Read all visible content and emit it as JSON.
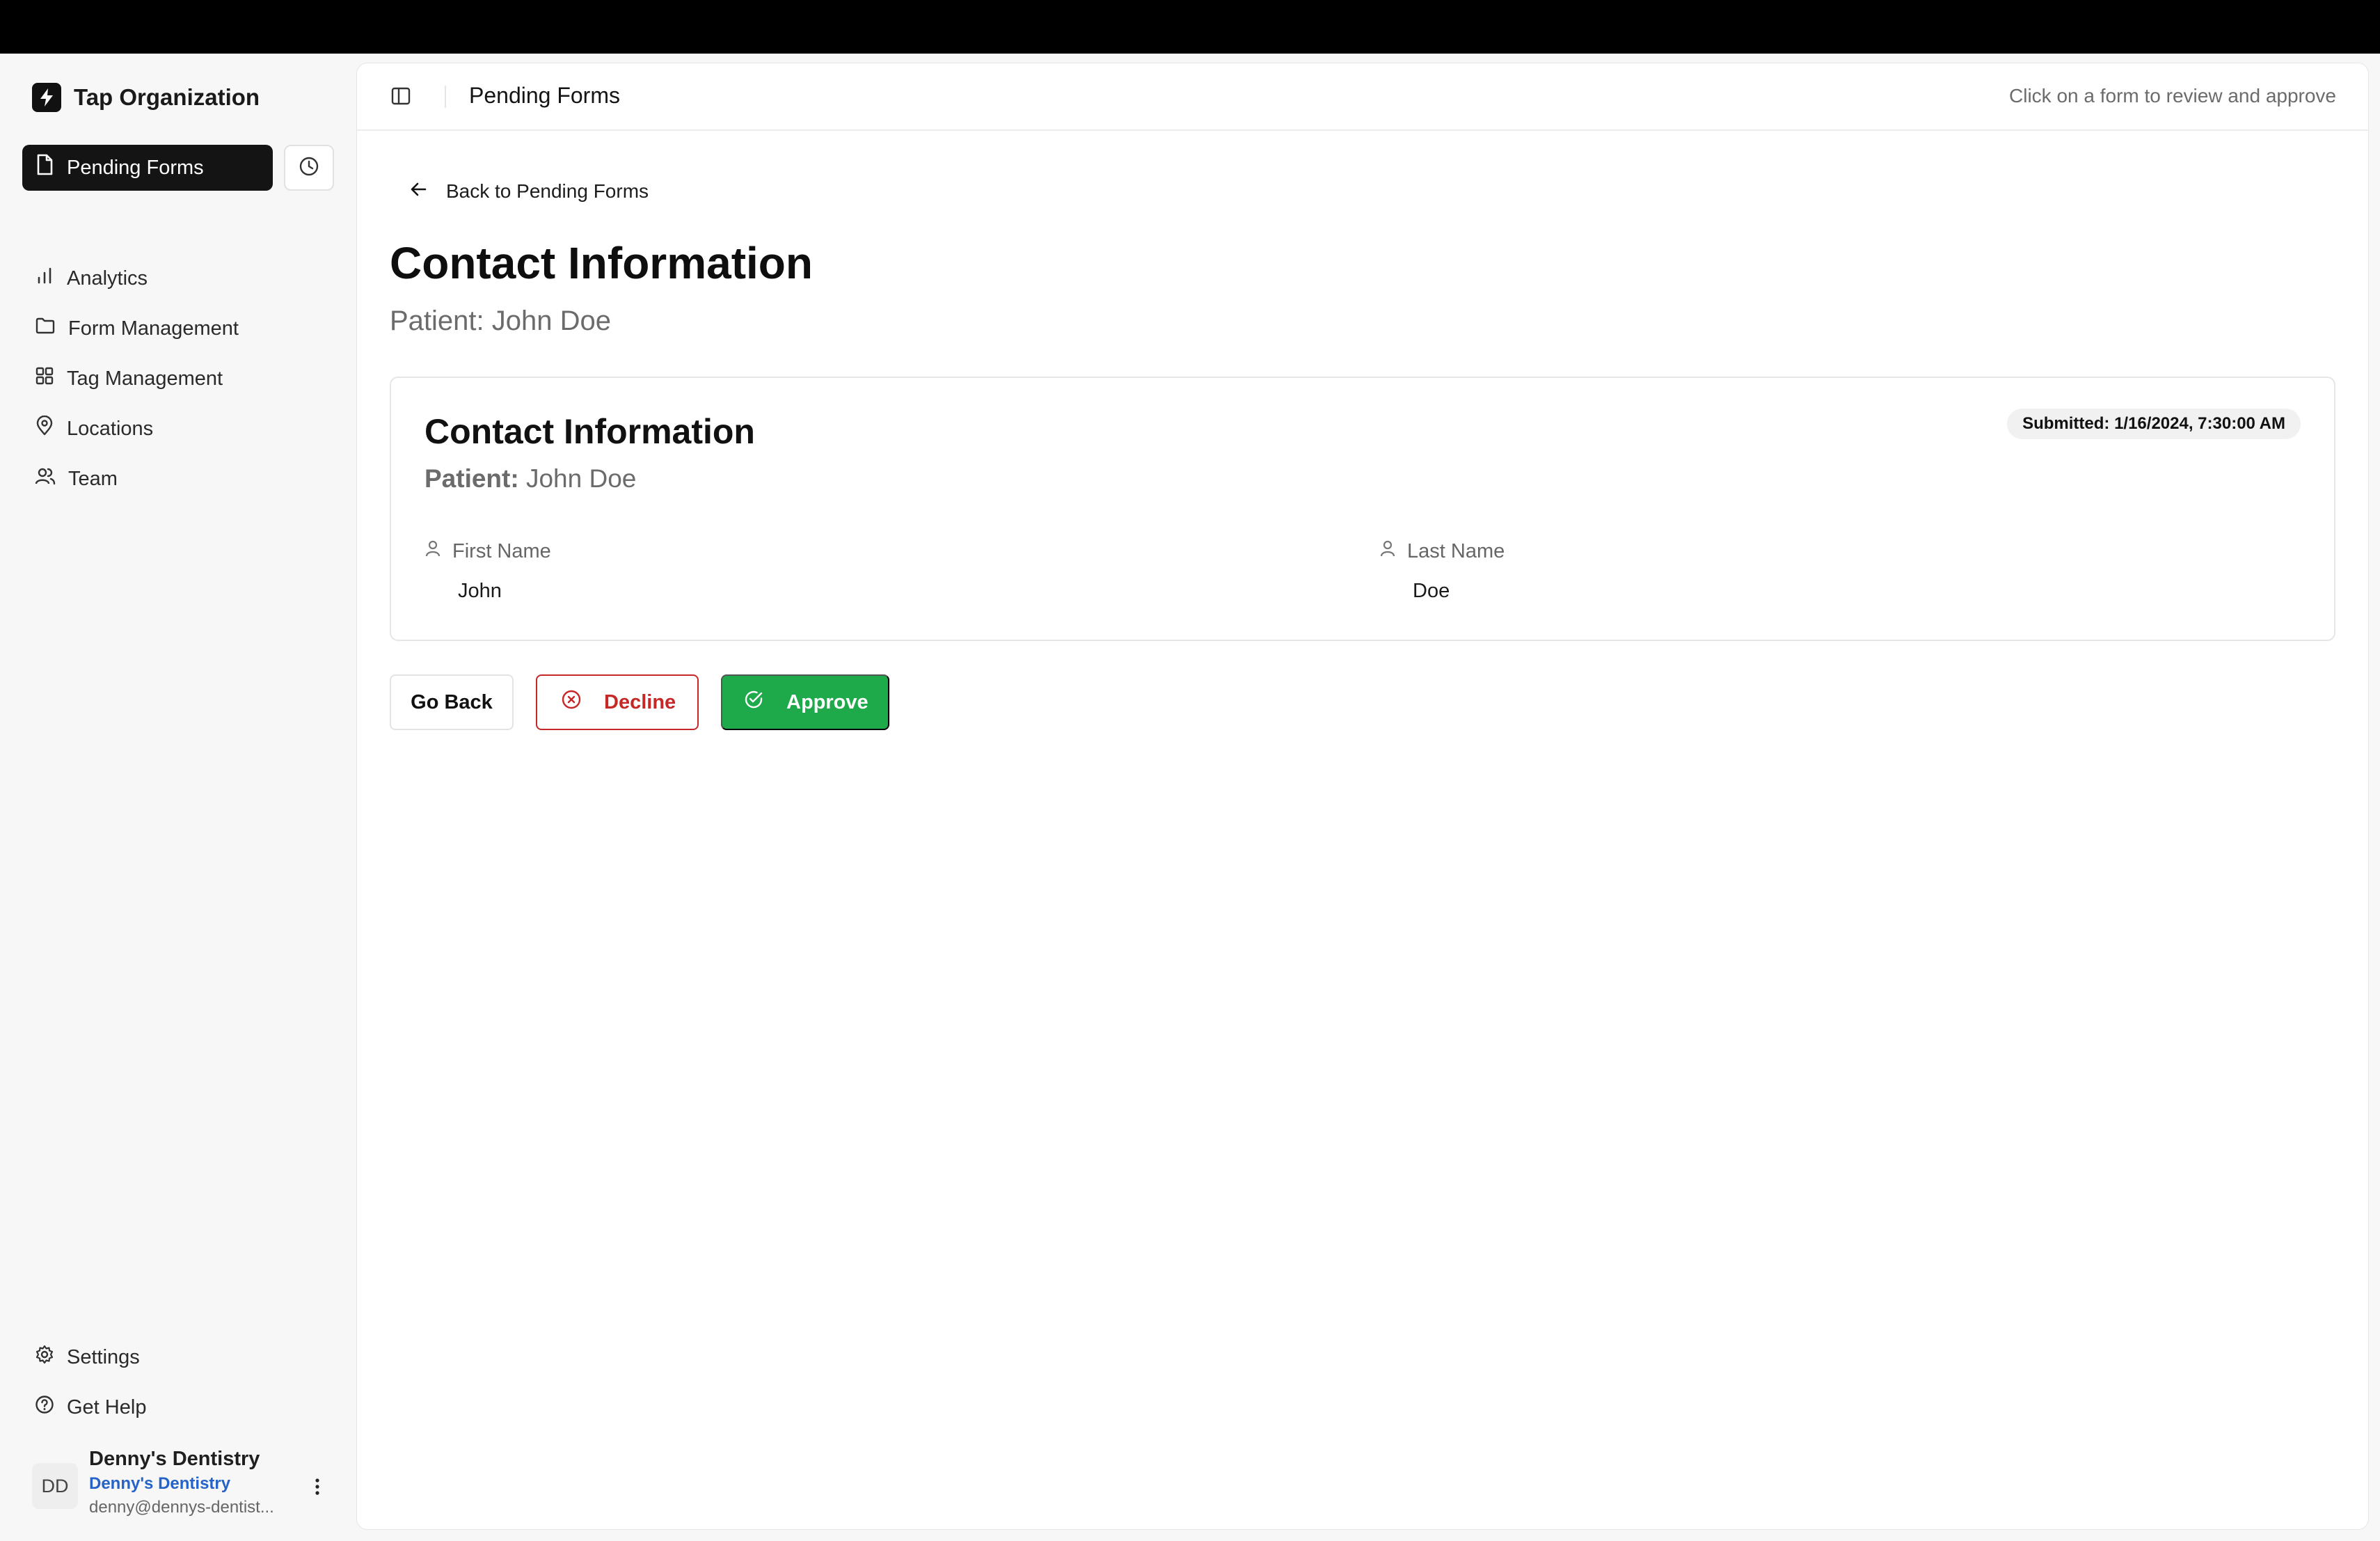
{
  "sidebar": {
    "brand": "Tap Organization",
    "active_item": "Pending Forms",
    "items": [
      {
        "label": "Analytics",
        "icon": "bar-chart-icon"
      },
      {
        "label": "Form Management",
        "icon": "folder-icon"
      },
      {
        "label": "Tag Management",
        "icon": "grid-icon"
      },
      {
        "label": "Locations",
        "icon": "map-pin-icon"
      },
      {
        "label": "Team",
        "icon": "users-icon"
      }
    ],
    "settings_label": "Settings",
    "help_label": "Get Help",
    "user": {
      "initials": "DD",
      "name": "Denny's Dentistry",
      "organization": "Denny's Dentistry",
      "email": "denny@dennys-dentist..."
    }
  },
  "topbar": {
    "title": "Pending Forms",
    "hint": "Click on a form to review and approve"
  },
  "page": {
    "back_label": "Back to Pending Forms",
    "title": "Contact Information",
    "subtitle": "Patient: John Doe"
  },
  "card": {
    "title": "Contact Information",
    "patient_label": "Patient:",
    "patient_name": "John Doe",
    "submitted": "Submitted: 1/16/2024, 7:30:00 AM",
    "fields": [
      {
        "label": "First Name",
        "value": "John"
      },
      {
        "label": "Last Name",
        "value": "Doe"
      }
    ]
  },
  "actions": {
    "go_back": "Go Back",
    "decline": "Decline",
    "approve": "Approve"
  },
  "colors": {
    "active_nav_bg": "#141414",
    "approve": "#1ea94a",
    "decline": "#c62828",
    "org_link": "#2563c9"
  }
}
